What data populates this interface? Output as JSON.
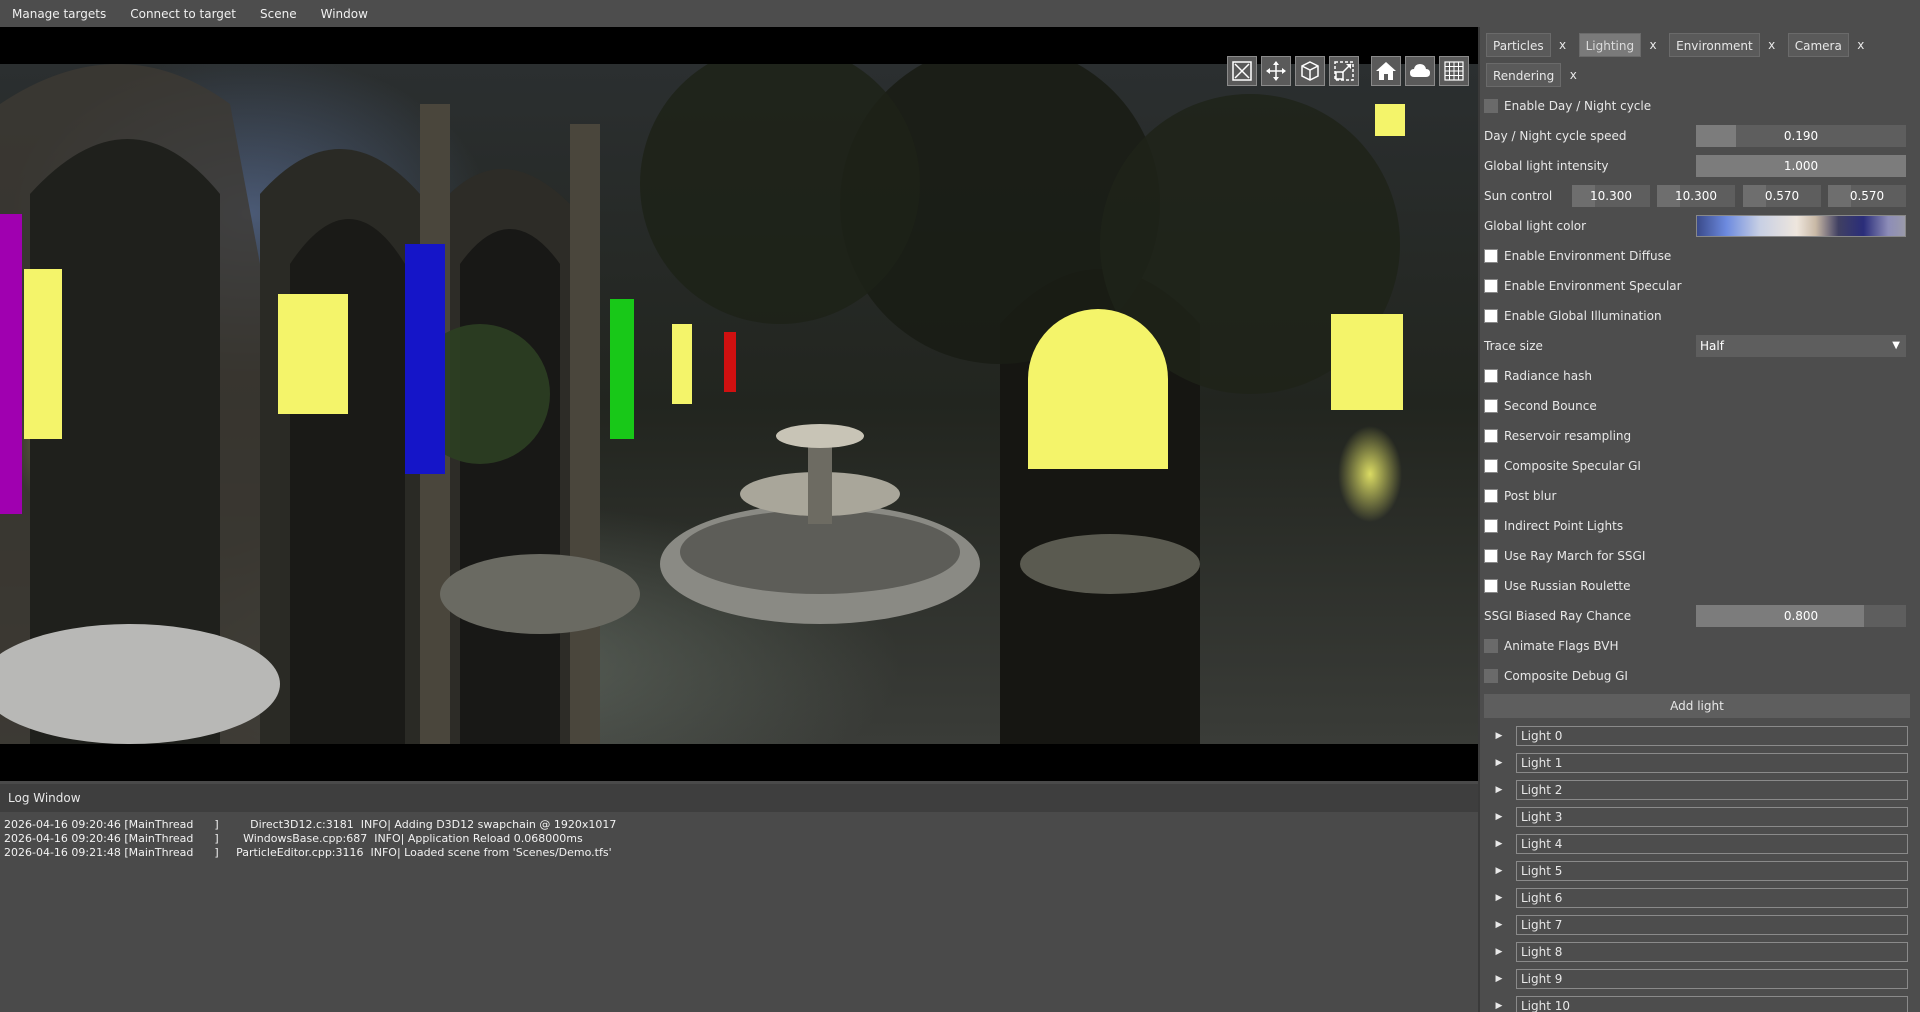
{
  "menu": [
    "Manage targets",
    "Connect to target",
    "Scene",
    "Window"
  ],
  "toolbar": {
    "tools": [
      {
        "name": "select-tool-icon"
      },
      {
        "name": "move-tool-icon"
      },
      {
        "name": "rotate-tool-icon"
      },
      {
        "name": "scale-tool-icon"
      }
    ],
    "toggles": [
      {
        "name": "home-icon"
      },
      {
        "name": "cloud-icon"
      },
      {
        "name": "grid-icon"
      }
    ]
  },
  "log": {
    "title": "Log Window",
    "lines": [
      {
        "time": "2026-04-16 09:20:46",
        "thread": "[MainThread      ]",
        "src": "         Direct3D12.c:3181",
        "msg": "  INFO| Adding D3D12 swapchain @ 1920x1017"
      },
      {
        "time": "2026-04-16 09:20:46",
        "thread": "[MainThread      ]",
        "src": "       WindowsBase.cpp:687",
        "msg": "  INFO| Application Reload 0.068000ms"
      },
      {
        "time": "2026-04-16 09:21:48",
        "thread": "[MainThread      ]",
        "src": "     ParticleEditor.cpp:3116",
        "msg": "  INFO| Loaded scene from 'Scenes/Demo.tfs'"
      }
    ]
  },
  "tabs": [
    {
      "label": "Particles",
      "active": false
    },
    {
      "label": "Lighting",
      "active": true
    },
    {
      "label": "Environment",
      "active": false
    },
    {
      "label": "Camera",
      "active": false
    },
    {
      "label": "Rendering",
      "active": false
    }
  ],
  "tab_close": "x",
  "lighting": {
    "enable_day_night": {
      "label": "Enable Day / Night cycle",
      "checked": false
    },
    "day_night_speed": {
      "label": "Day / Night cycle speed",
      "value": "0.190",
      "fraction": 0.19
    },
    "global_intensity": {
      "label": "Global light intensity",
      "value": "1.000",
      "fraction": 1.0
    },
    "sun_control": {
      "label": "Sun control",
      "values": [
        "10.300",
        "10.300",
        "0.570",
        "0.570"
      ]
    },
    "global_color": {
      "label": "Global light color"
    },
    "env_diffuse": {
      "label": "Enable Environment Diffuse",
      "checked": true
    },
    "env_specular": {
      "label": "Enable Environment Specular",
      "checked": true
    },
    "global_illum": {
      "label": "Enable Global Illumination",
      "checked": true
    },
    "trace_size": {
      "label": "Trace size",
      "value": "Half"
    },
    "radiance_hash": {
      "label": "Radiance hash",
      "checked": true
    },
    "second_bounce": {
      "label": "Second Bounce",
      "checked": true
    },
    "reservoir": {
      "label": "Reservoir resampling",
      "checked": true
    },
    "composite_spec": {
      "label": "Composite Specular GI",
      "checked": true
    },
    "post_blur": {
      "label": "Post blur",
      "checked": true
    },
    "indirect_point": {
      "label": "Indirect Point Lights",
      "checked": true
    },
    "ray_march": {
      "label": "Use Ray March for SSGI",
      "checked": true
    },
    "russian_roulette": {
      "label": "Use Russian Roulette",
      "checked": true
    },
    "ssgi_biased": {
      "label": "SSGI Biased Ray Chance",
      "value": "0.800",
      "fraction": 0.8
    },
    "animate_flags": {
      "label": "Animate Flags BVH",
      "checked": false
    },
    "composite_debug": {
      "label": "Composite Debug GI",
      "checked": false
    },
    "add_light": "Add light",
    "lights": [
      "Light 0",
      "Light 1",
      "Light 2",
      "Light 3",
      "Light 4",
      "Light 5",
      "Light 6",
      "Light 7",
      "Light 8",
      "Light 9",
      "Light 10"
    ]
  }
}
